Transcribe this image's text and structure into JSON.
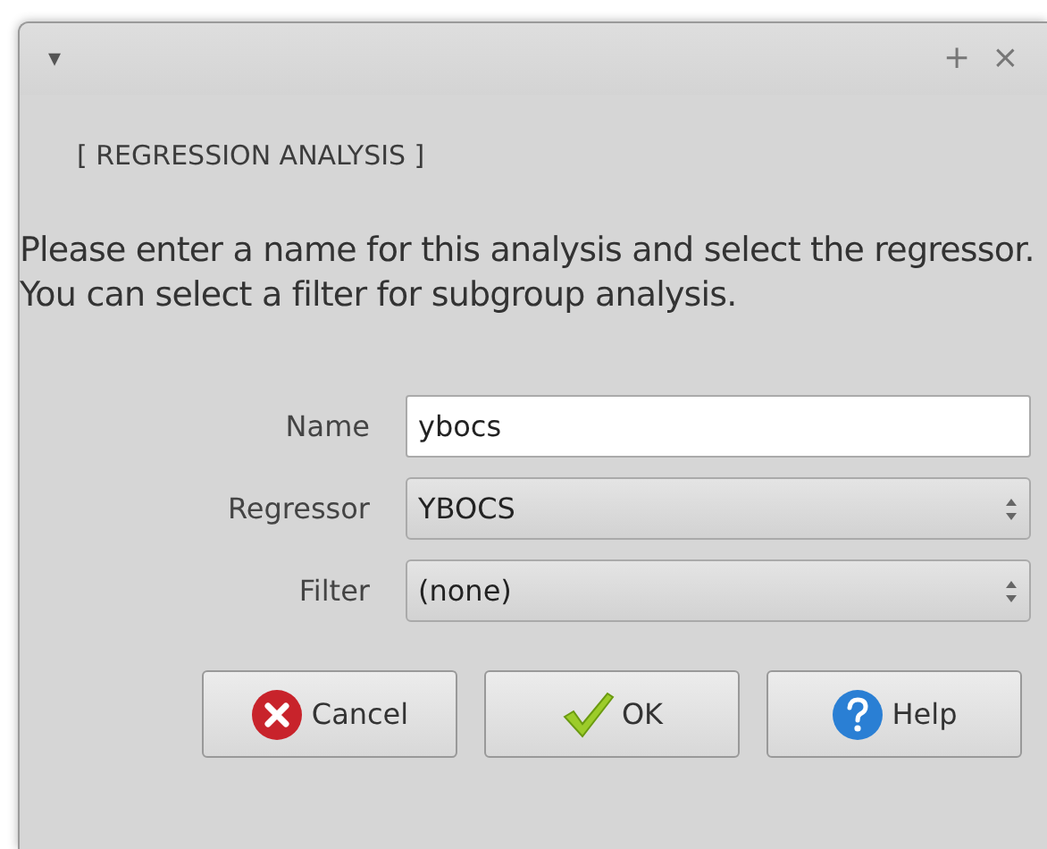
{
  "window": {
    "menu_glyph": "▾",
    "title_buttons": [
      "+",
      "×"
    ]
  },
  "heading": "[ REGRESSION ANALYSIS ]",
  "instructions": "Please enter a name for this analysis and select the regressor. You can select a filter for subgroup analysis.",
  "form": [
    {
      "kind": "text",
      "label": "Name",
      "value": "ybocs"
    },
    {
      "kind": "select",
      "label": "Regressor",
      "value": "YBOCS"
    },
    {
      "kind": "select",
      "label": "Filter",
      "value": "(none)"
    }
  ],
  "buttons": [
    {
      "kind": "cancel",
      "label": "Cancel"
    },
    {
      "kind": "ok",
      "label": "OK"
    },
    {
      "kind": "help",
      "label": "Help"
    }
  ]
}
